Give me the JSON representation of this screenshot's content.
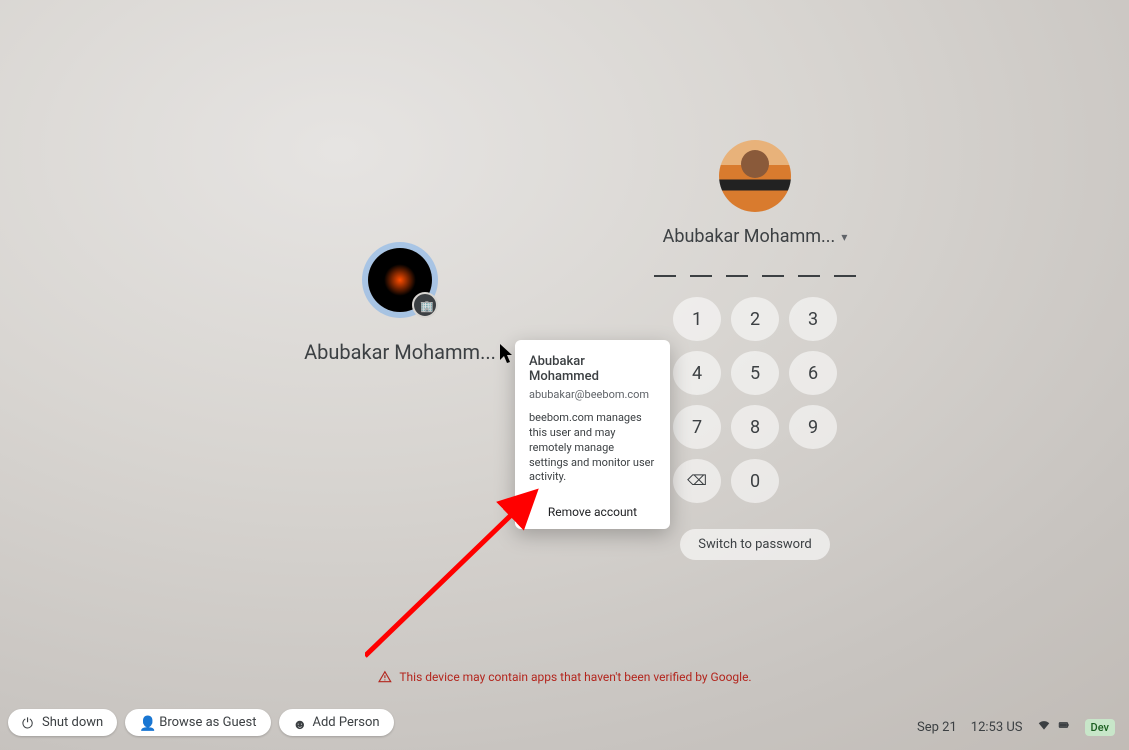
{
  "left_user": {
    "name_truncated": "Abubakar Mohamm...",
    "name_full": "Abubakar Mohammed",
    "enterprise_icon": "building-icon"
  },
  "popover": {
    "name": "Abubakar Mohammed",
    "email": "abubakar@beebom.com",
    "management_text": "beebom.com manages this user and may remotely manage settings and monitor user activity.",
    "remove_label": "Remove account"
  },
  "primary_user": {
    "name_truncated": "Abubakar Mohamm...",
    "pin_digits": 6,
    "switch_label": "Switch to password",
    "pad": [
      "1",
      "2",
      "3",
      "4",
      "5",
      "6",
      "7",
      "8",
      "9",
      "⌫",
      "0",
      ""
    ]
  },
  "warning_text": "This device may contain apps that haven't been verified by Google.",
  "shelf": {
    "shutdown": "Shut down",
    "guest": "Browse as Guest",
    "add": "Add Person"
  },
  "status": {
    "date": "Sep 21",
    "time": "12:53",
    "locale": "US",
    "dev_badge": "Dev"
  }
}
